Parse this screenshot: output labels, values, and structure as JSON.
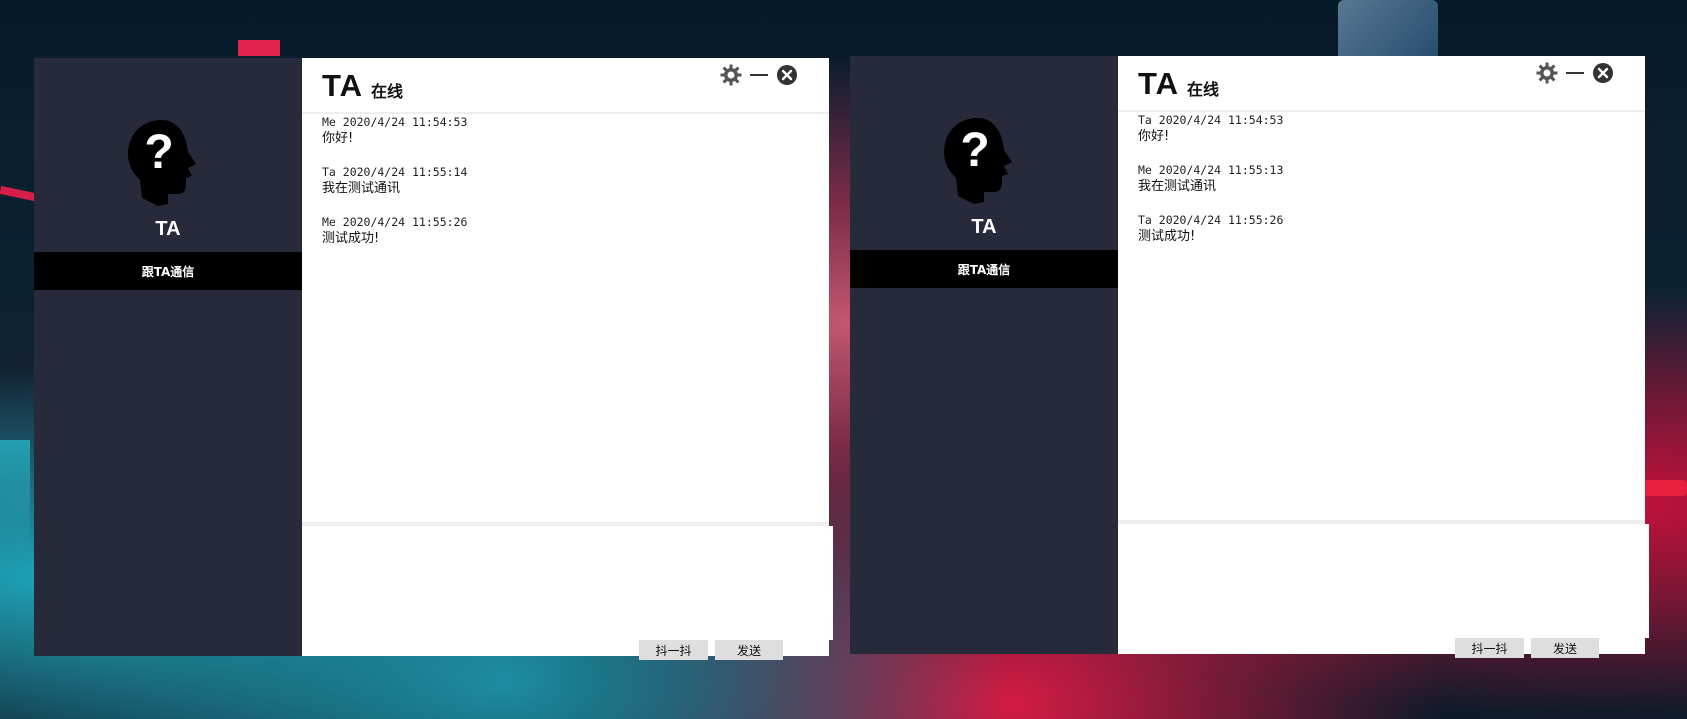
{
  "windows": [
    {
      "contact_name": "TA",
      "contact_action": "跟TA通信",
      "header": {
        "title": "TA",
        "status": "在线"
      },
      "messages": [
        {
          "meta": "Me 2020/4/24 11:54:53",
          "text": "你好!"
        },
        {
          "meta": "Ta 2020/4/24 11:55:14",
          "text": "我在测试通讯"
        },
        {
          "meta": "Me 2020/4/24 11:55:26",
          "text": "测试成功!"
        }
      ],
      "input_value": "",
      "buttons": {
        "shake": "抖一抖",
        "send": "发送"
      }
    },
    {
      "contact_name": "TA",
      "contact_action": "跟TA通信",
      "header": {
        "title": "TA",
        "status": "在线"
      },
      "messages": [
        {
          "meta": "Ta 2020/4/24 11:54:53",
          "text": "你好!"
        },
        {
          "meta": "Me 2020/4/24 11:55:13",
          "text": "我在测试通讯"
        },
        {
          "meta": "Ta 2020/4/24 11:55:26",
          "text": "测试成功!"
        }
      ],
      "input_value": "",
      "buttons": {
        "shake": "抖一抖",
        "send": "发送"
      }
    }
  ],
  "icons": {
    "settings": "gear-icon",
    "minimize": "minimize-icon",
    "close": "close-icon",
    "avatar": "unknown-person-icon"
  },
  "colors": {
    "sidebar": "#262a3b",
    "contact_bar": "#000000",
    "button": "#dedede"
  }
}
